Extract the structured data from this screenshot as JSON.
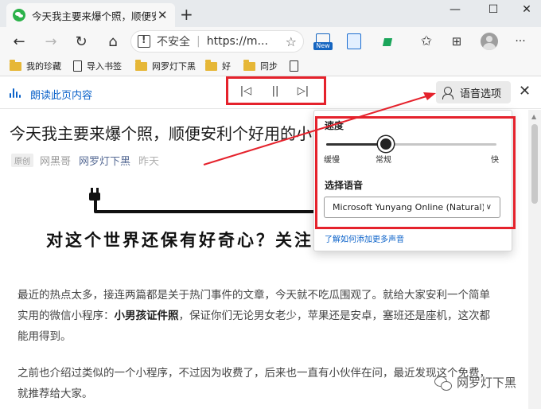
{
  "tab": {
    "title": "今天我主要来爆个照，顺便安利个小",
    "close_glyph": "✕",
    "new_tab_glyph": "+"
  },
  "window": {
    "minimize": "—",
    "maximize": "☐",
    "close": "✕"
  },
  "toolbar": {
    "back_glyph": "←",
    "forward_glyph": "→",
    "reload_glyph": "↻",
    "home_glyph": "⌂",
    "insecure_label": "不安全",
    "separator": "|",
    "url": "https://m...",
    "ext_new_label": "New",
    "menu_glyph": "···"
  },
  "bookmarks": [
    {
      "label": "我的珍藏",
      "type": "folder"
    },
    {
      "label": "导入书签",
      "type": "page"
    },
    {
      "label": "网罗灯下黑",
      "type": "folder"
    },
    {
      "label": "好",
      "type": "folder"
    },
    {
      "label": "同步",
      "type": "folder"
    },
    {
      "label": "",
      "type": "page"
    }
  ],
  "reader": {
    "read_label": "朗读此页内容",
    "prev_glyph": "|◁",
    "pause_glyph": "||",
    "next_glyph": "▷|",
    "voice_options_label": "语音选项",
    "close_glyph": "✕"
  },
  "article": {
    "title": "今天我主要来爆个照，顺便安利个好用的小",
    "original_badge": "原创",
    "author": "网黑哥",
    "account": "网罗灯下黑",
    "date": "昨天",
    "banner_text": "对这个世界还保有好奇心？关注",
    "para1_a": "最近的热点太多，接连两篇都是关于热门事件的文章，今天就不吃瓜围观了。就给大家安利一个简单实用的微信小程序：",
    "para1_b": "小男孩证件照",
    "para1_c": "，保证你们无论男女老少，苹果还是安卓，塞班还是座机，这次都能用得到。",
    "para2": "之前也介绍过类似的一个小程序，不过因为收费了，后来也一直有小伙伴在问，最近发现这个免费，就推荐给大家。",
    "watermark": "网罗灯下黑"
  },
  "voice_popup": {
    "speed_label": "速度",
    "speed_value": 0.35,
    "tick_slow": "缓慢",
    "tick_normal": "常规",
    "tick_fast": "快",
    "voice_label": "选择语音",
    "voice_selected": "Microsoft Yunyang Online (Natural) - Chinese",
    "chevron_glyph": "∨",
    "more_voices_link": "了解如何添加更多声音"
  },
  "colors": {
    "accent": "#0b62c9",
    "annotation_red": "#e5222c",
    "account_link": "#576b95"
  }
}
